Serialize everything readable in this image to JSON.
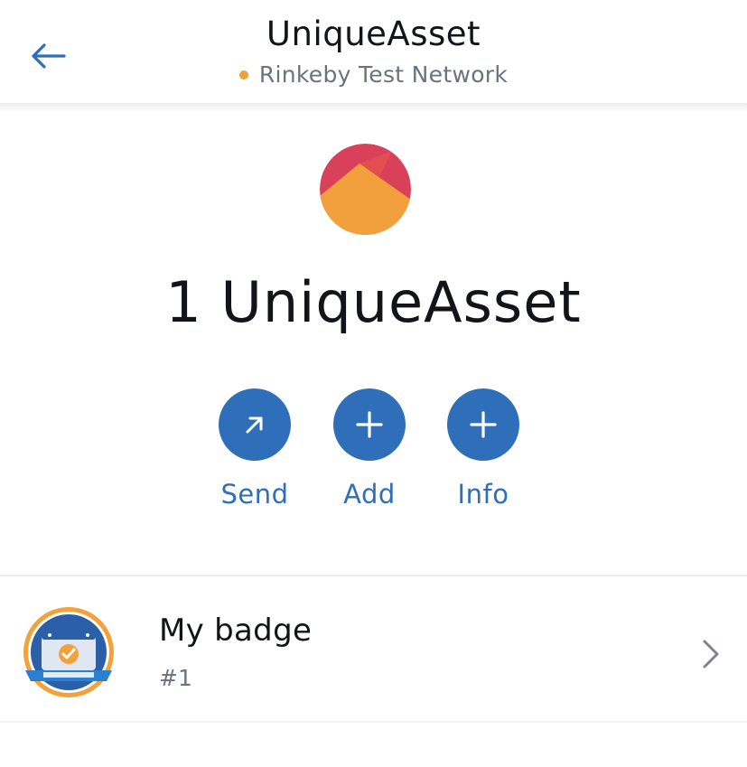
{
  "header": {
    "title": "UniqueAsset",
    "network": "Rinkeby Test Network",
    "back_icon": "arrow-left-icon"
  },
  "token": {
    "logo_icon": "token-mountain-icon",
    "balance": "1 UniqueAsset"
  },
  "actions": [
    {
      "label": "Send",
      "icon": "arrow-up-right-icon"
    },
    {
      "label": "Add",
      "icon": "plus-icon"
    },
    {
      "label": "Info",
      "icon": "plus-icon"
    }
  ],
  "collectibles": [
    {
      "name": "My badge",
      "id": "#1",
      "thumb_icon": "badge-image-icon",
      "chevron_icon": "chevron-right-icon"
    }
  ],
  "colors": {
    "accent": "#2f6eb8",
    "network_dot": "#f0a03a",
    "logo_red": "#d9405a",
    "logo_orange": "#f2a03d"
  }
}
